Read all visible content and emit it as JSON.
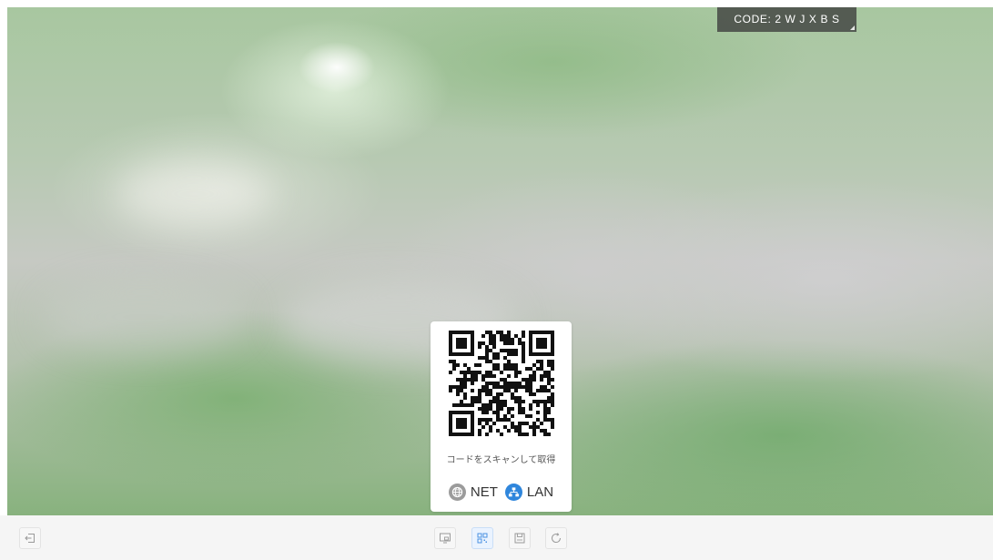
{
  "preview": {
    "code_label": "CODE: 2 W J X B S"
  },
  "qr_card": {
    "caption": "コードをスキャンして取得",
    "network_options": [
      {
        "label": "NET",
        "icon": "globe-icon",
        "selected": false,
        "color": "#9b9b9b"
      },
      {
        "label": "LAN",
        "icon": "lan-icon",
        "selected": true,
        "color": "#2f86dc"
      }
    ]
  },
  "toolbar": {
    "buttons": [
      {
        "icon": "exit-icon",
        "active": false
      },
      {
        "icon": "screen-share-icon",
        "active": false
      },
      {
        "icon": "qr-code-icon",
        "active": true
      },
      {
        "icon": "save-icon",
        "active": false
      },
      {
        "icon": "refresh-icon",
        "active": false
      }
    ]
  },
  "colors": {
    "accent": "#2f86dc",
    "toolbar_bg": "#f5f5f5",
    "code_tag_bg": "#3c3c3c"
  }
}
